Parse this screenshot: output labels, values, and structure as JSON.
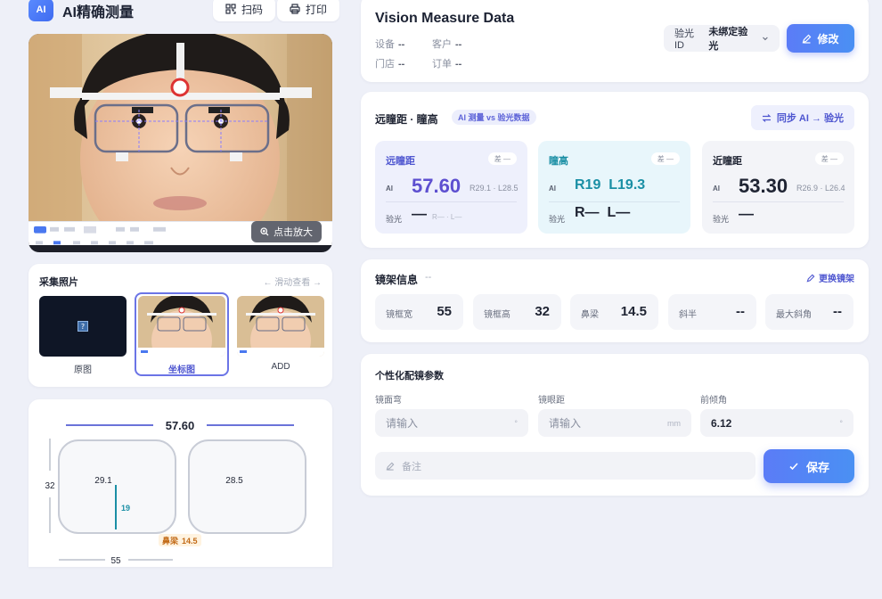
{
  "app": {
    "logo": "AI",
    "title": "AI精确测量"
  },
  "header_buttons": {
    "scan": "扫码",
    "print": "打印"
  },
  "photo": {
    "zoom_label": "点击放大"
  },
  "collect": {
    "title": "采集照片",
    "hint": "← 滑动查看 →",
    "items": [
      {
        "label": "原图",
        "selected": false
      },
      {
        "label": "坐标图",
        "selected": true
      },
      {
        "label": "ADD",
        "selected": false
      }
    ]
  },
  "diagram": {
    "total": "57.60",
    "height": "32",
    "left_pd": "29.1",
    "right_pd": "28.5",
    "seg_height": "19",
    "bridge_label": "鼻梁",
    "bridge_value": "14.5",
    "width": "55"
  },
  "vision": {
    "title": "Vision Measure Data",
    "device_label": "设备",
    "device_value": "--",
    "customer_label": "客户",
    "customer_value": "--",
    "store_label": "门店",
    "store_value": "--",
    "order_label": "订单",
    "order_value": "--",
    "optometry_id_label": "验光ID",
    "optometry_id_value": "未绑定验光",
    "edit_label": "修改"
  },
  "pd": {
    "title": "远瞳距 · 瞳高",
    "tag": "AI 测量 vs 验光数据",
    "sync_label": "同步 AI → 验光",
    "boxes": [
      {
        "name": "远瞳距",
        "diff": "差 —",
        "ai_label": "AI",
        "ai_value": "57.60",
        "ai_sub": "R29.1 · L28.5",
        "exp_label": "验光",
        "exp_value": "—",
        "exp_sub": "R— · L—"
      },
      {
        "name": "瞳高",
        "diff": "差 —",
        "ai_label": "AI",
        "ai_value": "R19  L19.3",
        "exp_label": "验光",
        "exp_value": "R—  L—"
      },
      {
        "name": "近瞳距",
        "diff": "差 —",
        "ai_label": "AI",
        "ai_value": "53.30",
        "ai_sub": "R26.9 · L26.4",
        "exp_label": "验光",
        "exp_value": "—"
      }
    ]
  },
  "frame": {
    "title": "镜架信息",
    "subtitle": "--",
    "replace_label": "更换镜架",
    "chips": [
      {
        "label": "镜框宽",
        "value": "55"
      },
      {
        "label": "镜框高",
        "value": "32"
      },
      {
        "label": "鼻梁",
        "value": "14.5"
      },
      {
        "label": "斜半",
        "value": "--"
      },
      {
        "label": "最大斜角",
        "value": "--"
      }
    ]
  },
  "params": {
    "title": "个性化配镜参数",
    "fields": [
      {
        "label": "镜面弯",
        "placeholder": "请输入",
        "value": "",
        "unit": "°"
      },
      {
        "label": "镜眼距",
        "placeholder": "请输入",
        "value": "",
        "unit": "mm"
      },
      {
        "label": "前倾角",
        "placeholder": "",
        "value": "6.12",
        "unit": "°"
      }
    ],
    "note_placeholder": "备注",
    "save_label": "保存"
  },
  "colors": {
    "accent": "#5b7cf7",
    "indigo": "#5d63d8",
    "teal": "#1a8fa5",
    "pd_box_1": "#eef0fc",
    "pd_box_2": "#e8f6fb",
    "pd_box_3": "#f3f4f8"
  }
}
